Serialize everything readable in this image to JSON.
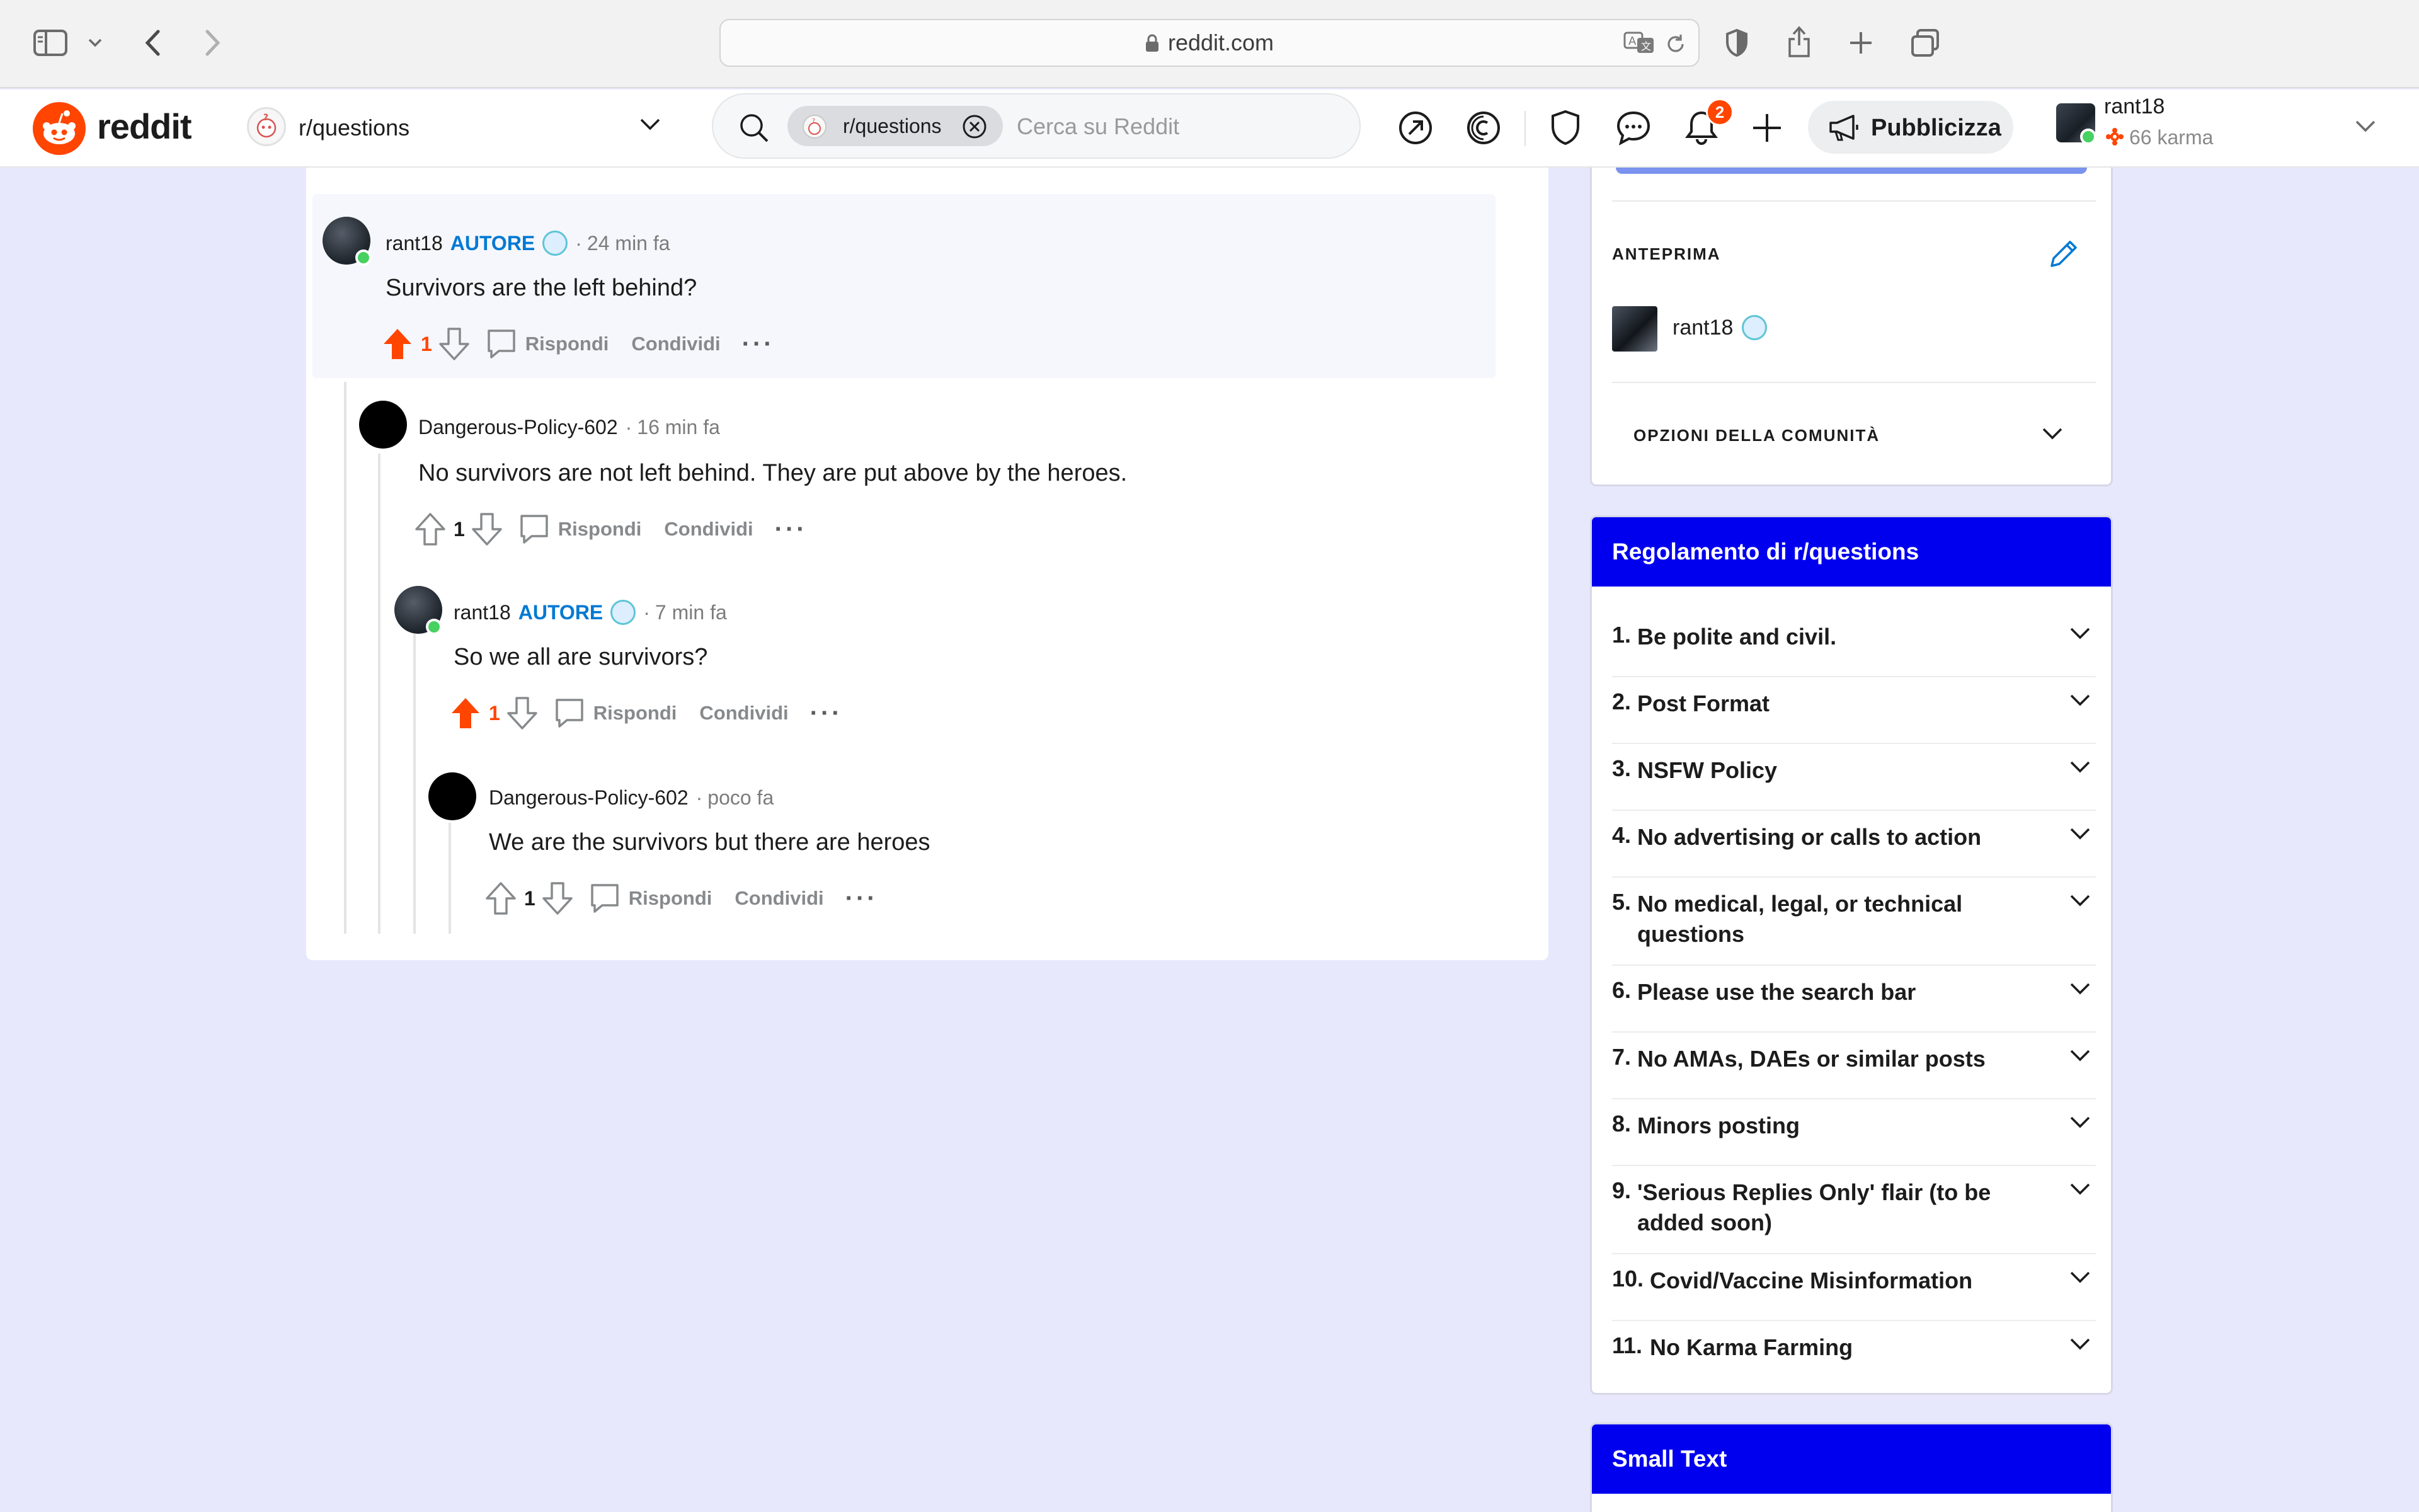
{
  "browser": {
    "url": "reddit.com"
  },
  "header": {
    "logo_text": "reddit",
    "subreddit": "r/questions",
    "search_chip": "r/questions",
    "search_placeholder": "Cerca su Reddit",
    "notification_count": "2",
    "promote_label": "Pubblicizza",
    "user_name": "rant18",
    "user_karma": "66 karma"
  },
  "comments": [
    {
      "author": "rant18",
      "op_label": "AUTORE",
      "time": "24 min fa",
      "body": "Survivors are the left behind?",
      "votes": "1",
      "upvoted": true,
      "reply": "Rispondi",
      "share": "Condividi"
    },
    {
      "author": "Dangerous-Policy-602",
      "time": "16 min fa",
      "body": "No survivors are not left behind. They are put above by the heroes.",
      "votes": "1",
      "upvoted": false,
      "reply": "Rispondi",
      "share": "Condividi"
    },
    {
      "author": "rant18",
      "op_label": "AUTORE",
      "time": "7 min fa",
      "body": "So we all are survivors?",
      "votes": "1",
      "upvoted": true,
      "reply": "Rispondi",
      "share": "Condividi"
    },
    {
      "author": "Dangerous-Policy-602",
      "time": "poco fa",
      "body": "We are the survivors but there are heroes",
      "votes": "1",
      "upvoted": false,
      "reply": "Rispondi",
      "share": "Condividi"
    }
  ],
  "sidebar": {
    "preview_title": "ANTEPRIMA",
    "preview_user": "rant18",
    "community_options": "OPZIONI DELLA COMUNITÀ",
    "rules_title": "Regolamento di r/questions",
    "rules": [
      {
        "num": "1.",
        "text": "Be polite and civil."
      },
      {
        "num": "2.",
        "text": "Post Format"
      },
      {
        "num": "3.",
        "text": "NSFW Policy"
      },
      {
        "num": "4.",
        "text": "No advertising or calls to action"
      },
      {
        "num": "5.",
        "text": "No medical, legal, or technical questions"
      },
      {
        "num": "6.",
        "text": "Please use the search bar"
      },
      {
        "num": "7.",
        "text": "No AMAs, DAEs or similar posts"
      },
      {
        "num": "8.",
        "text": "Minors posting"
      },
      {
        "num": "9.",
        "text": "'Serious Replies Only' flair (to be added soon)"
      },
      {
        "num": "10.",
        "text": "Covid/Vaccine Misinformation"
      },
      {
        "num": "11.",
        "text": "No Karma Farming"
      }
    ],
    "small_text_title": "Small Text"
  },
  "colors": {
    "upvote": "#ff4500",
    "op_blue": "#0079d3",
    "card_header": "#0000ee",
    "page_bg": "#e7e8fb"
  }
}
